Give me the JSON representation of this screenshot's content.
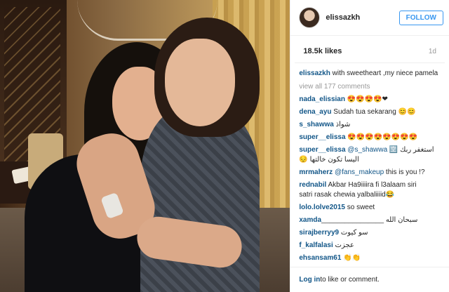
{
  "header": {
    "username": "elissazkh",
    "follow_label": "FOLLOW"
  },
  "meta": {
    "likes": "18.5k likes",
    "age": "1d"
  },
  "caption": {
    "user": "elissazkh",
    "text": " with sweetheart ,my niece pamela"
  },
  "view_all": "view all 177 comments",
  "comments": [
    {
      "user": "nada_elissian",
      "text": " 😍😍😍😍❤"
    },
    {
      "user": "dena_ayu",
      "text": " Sudah tua sekarang 😊😊"
    },
    {
      "user": "s_shawwa",
      "text": " شواذ"
    },
    {
      "user": "super__elissa",
      "text": " 😍😍😍😍😍😍😍😍"
    },
    {
      "user": "super__elissa",
      "mention": " @s_shawwa",
      "text": " 🈳 استغفر ربك"
    },
    {
      "user": "",
      "text": "😔 اليسا تكون خالتها"
    },
    {
      "user": "mrmaherz",
      "mention": " @fans_makeup",
      "text": " this is you !?"
    },
    {
      "user": "rednabil",
      "text": " Akbar Ha9iiiira fi l3alaam siri"
    },
    {
      "user": "",
      "text": "satri rasak chewia yalbaliiiid😂"
    },
    {
      "user": "lolo.lolve2015",
      "text": " so sweet"
    },
    {
      "user": "xamda",
      "text": "________________ سبحان الله"
    },
    {
      "user": "sirajberryy9",
      "text": " سو كيوت"
    },
    {
      "user": "f_kalfalasi",
      "text": " عجزت"
    },
    {
      "user": "ehsansam61",
      "text": " 👏👏"
    }
  ],
  "login": {
    "link": "Log in",
    "text": " to like or comment."
  }
}
